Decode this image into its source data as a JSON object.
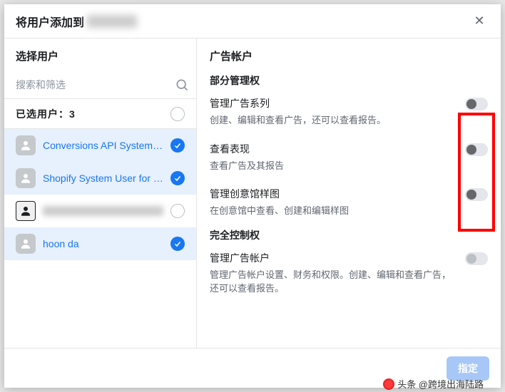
{
  "modal": {
    "title_prefix": "将用户添加到",
    "close_glyph": "✕"
  },
  "left": {
    "section_title": "选择用户",
    "search_placeholder": "搜索和筛选",
    "selected_prefix": "已选用户：",
    "selected_count": "3",
    "users": [
      {
        "name": "Conversions API System U...",
        "selected": true,
        "style": "link"
      },
      {
        "name": "Shopify System User for Re...",
        "selected": true,
        "style": "link"
      },
      {
        "name": "",
        "selected": false,
        "style": "blurred"
      },
      {
        "name": "hoon da",
        "selected": true,
        "style": "link"
      }
    ]
  },
  "right": {
    "title": "广告帐户",
    "group1": "部分管理权",
    "perms": [
      {
        "label": "管理广告系列",
        "desc": "创建、编辑和查看广告，还可以查看报告。"
      },
      {
        "label": "查看表现",
        "desc": "查看广告及其报告"
      },
      {
        "label": "管理创意馆样图",
        "desc": "在创意馆中查看、创建和编辑样图"
      }
    ],
    "group2": "完全控制权",
    "perm_full": {
      "label": "管理广告帐户",
      "desc": "管理广告帐户设置、财务和权限。创建、编辑和查看广告，还可以查看报告。"
    }
  },
  "footer": {
    "primary": "指定"
  },
  "watermark": "头条 @跨境出海陆路"
}
